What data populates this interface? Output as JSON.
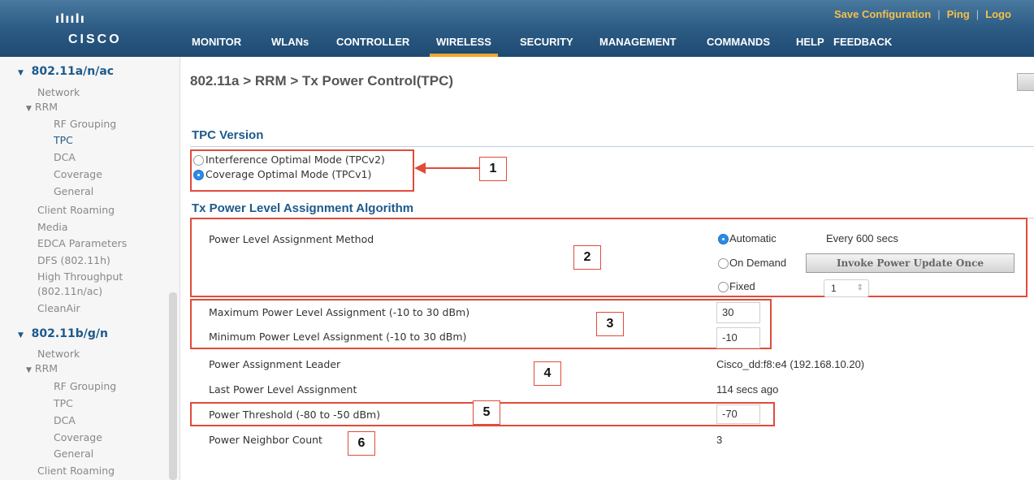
{
  "header": {
    "logo_bars": "ılıılı",
    "logo_text": "CISCO",
    "top_links": [
      "Save Configuration",
      "Ping",
      "Logo"
    ],
    "nav": [
      "MONITOR",
      "WLANs",
      "CONTROLLER",
      "WIRELESS",
      "SECURITY",
      "MANAGEMENT",
      "COMMANDS",
      "HELP",
      "FEEDBACK"
    ],
    "active_nav": "WIRELESS"
  },
  "sidebar": {
    "group1": {
      "title": "802.11a/n/ac",
      "items": [
        "Network",
        "RRM",
        "RF Grouping",
        "TPC",
        "DCA",
        "Coverage",
        "General",
        "Client Roaming",
        "Media",
        "EDCA Parameters",
        "DFS (802.11h)",
        "High Throughput",
        "(802.11n/ac)",
        "CleanAir"
      ]
    },
    "group2": {
      "title": "802.11b/g/n",
      "items": [
        "Network",
        "RRM",
        "RF Grouping",
        "TPC",
        "DCA",
        "Coverage",
        "General",
        "Client Roaming"
      ]
    }
  },
  "content": {
    "page_title": "802.11a > RRM > Tx Power Control(TPC)",
    "tpc_version_title": "TPC Version",
    "tpc_options": [
      "Interference Optimal Mode (TPCv2)",
      "Coverage Optimal Mode (TPCv1)"
    ],
    "tpc_selected": "Coverage Optimal Mode (TPCv1)",
    "algo_title": "Tx Power Level Assignment Algorithm",
    "method_label": "Power Level Assignment Method",
    "method_options": [
      "Automatic",
      "On Demand",
      "Fixed"
    ],
    "method_selected": "Automatic",
    "every_text": "Every 600 secs",
    "invoke_button": "Invoke Power Update Once",
    "fixed_value": "1",
    "max_label": "Maximum Power Level Assignment (-10 to 30 dBm)",
    "max_value": "30",
    "min_label": "Minimum Power Level Assignment (-10 to 30 dBm)",
    "min_value": "-10",
    "leader_label": "Power Assignment Leader",
    "leader_value": "Cisco_dd:f8:e4 (192.168.10.20)",
    "last_label": "Last Power Level Assignment",
    "last_value": "114 secs ago",
    "threshold_label": "Power Threshold (-80 to -50 dBm)",
    "threshold_value": "-70",
    "neighbor_label": "Power Neighbor Count",
    "neighbor_value": "3",
    "callouts": [
      "1",
      "2",
      "3",
      "4",
      "5",
      "6"
    ],
    "annotation_color": "#e14b3b"
  }
}
